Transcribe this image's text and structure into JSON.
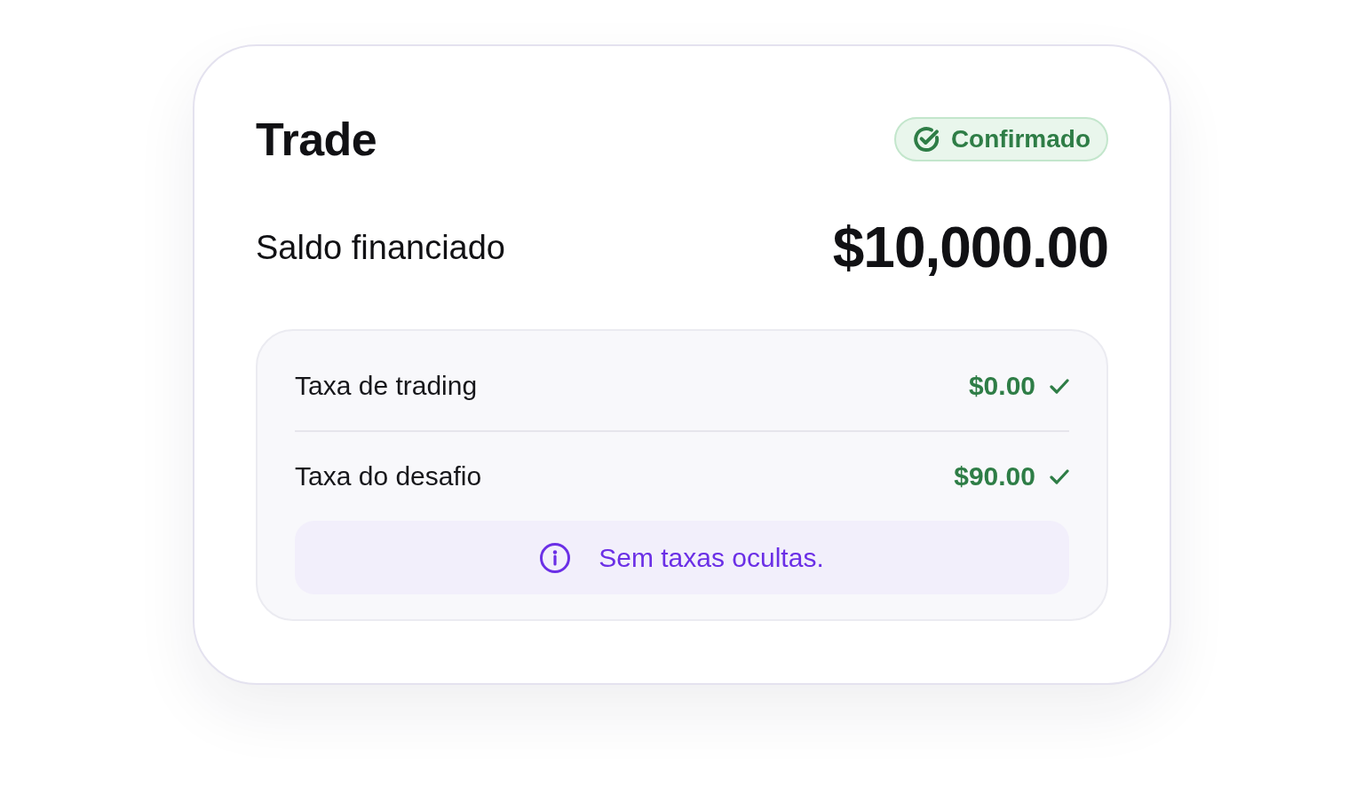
{
  "card": {
    "title": "Trade",
    "status": {
      "label": "Confirmado"
    }
  },
  "balance": {
    "label": "Saldo financiado",
    "amount": "$10,000.00"
  },
  "fees": [
    {
      "label": "Taxa de trading",
      "amount": "$0.00"
    },
    {
      "label": "Taxa do desafio",
      "amount": "$90.00"
    }
  ],
  "notice": {
    "text": "Sem taxas ocultas."
  }
}
